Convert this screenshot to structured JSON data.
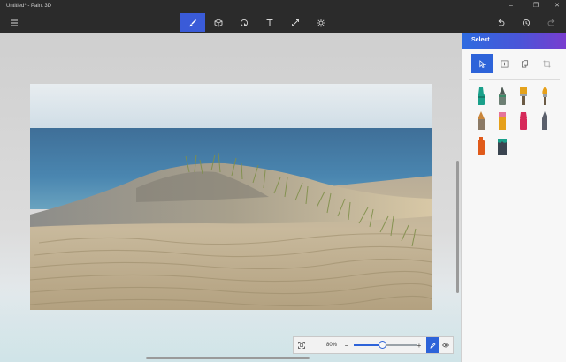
{
  "window": {
    "title": "Untitled* - Paint 3D",
    "controls": [
      "–",
      "❐",
      "✕"
    ]
  },
  "toolbar": {
    "menu_icon": "hamburger-menu-icon",
    "tools": [
      {
        "name": "brushes",
        "icon": "brush-icon",
        "active": true
      },
      {
        "name": "3d-shapes",
        "icon": "cube-icon",
        "active": false
      },
      {
        "name": "2d-shapes",
        "icon": "shape-icon",
        "active": false
      },
      {
        "name": "text",
        "icon": "text-icon",
        "active": false
      },
      {
        "name": "effects",
        "icon": "effects-icon",
        "active": false
      },
      {
        "name": "canvas",
        "icon": "sun-canvas-icon",
        "active": false
      }
    ],
    "right_tools": [
      "undo-icon",
      "history-icon",
      "redo-icon"
    ]
  },
  "panel": {
    "title": "Select",
    "select_tools": [
      "cursor-select",
      "region-select",
      "paste",
      "crop"
    ],
    "brushes": [
      {
        "name": "marker",
        "color": "#1aa08a"
      },
      {
        "name": "calligraphy-pen",
        "color": "#6d7f74"
      },
      {
        "name": "oil-brush",
        "color": "#e4a21c"
      },
      {
        "name": "watercolor",
        "color": "#e6a01a"
      },
      {
        "name": "pixel-pen",
        "color": "#c9853a"
      },
      {
        "name": "pencil",
        "color": "#e5749a"
      },
      {
        "name": "eraser",
        "color": "#d62a5a"
      },
      {
        "name": "crayon",
        "color": "#5a5f6b"
      },
      {
        "name": "spray-can",
        "color": "#e05a1a"
      },
      {
        "name": "fill",
        "color": "#3a4450"
      }
    ]
  },
  "zoom": {
    "percent_label": "80%",
    "minus": "−",
    "plus": "+",
    "value_fraction": 0.45
  },
  "colors": {
    "toolbar_bg": "#2b2b2b",
    "accent": "#2d63d9"
  }
}
